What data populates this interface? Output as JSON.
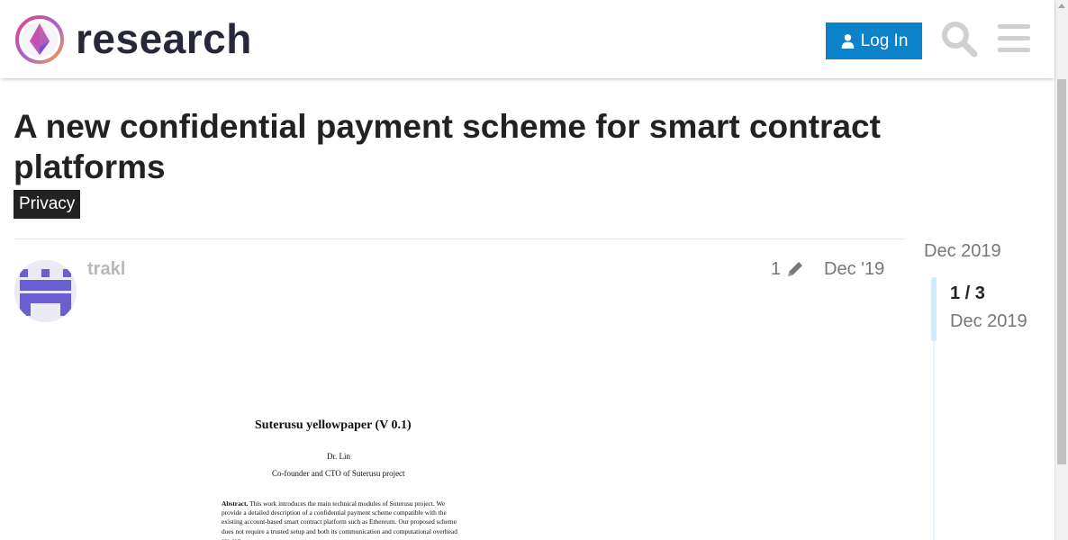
{
  "header": {
    "brand": "research",
    "login_label": "Log In",
    "colors": {
      "login_bg": "#0b82c9",
      "icon_gray": "#d0d0d0"
    }
  },
  "topic": {
    "title": "A new confidential payment scheme for smart contract platforms",
    "category": "Privacy"
  },
  "post": {
    "username": "trakl",
    "edit_count": "1",
    "date": "Dec '19",
    "paper": {
      "title": "Suterusu yellowpaper (V 0.1)",
      "author": "Dr. Lin",
      "affiliation": "Co-founder and CTO of Suterusu project",
      "abstract_label": "Abstract.",
      "abstract_text": "This work introduces the main technical modules of Suterusu project. We provide a detailed description of a confidential payment scheme compatible with the existing account-based smart contract platform such as Ethereum. Our proposed scheme does not require a trusted setup and both its communication and computational overhead are con-"
    }
  },
  "timeline": {
    "start_date": "Dec 2019",
    "position": "1 / 3",
    "current_date": "Dec 2019"
  }
}
